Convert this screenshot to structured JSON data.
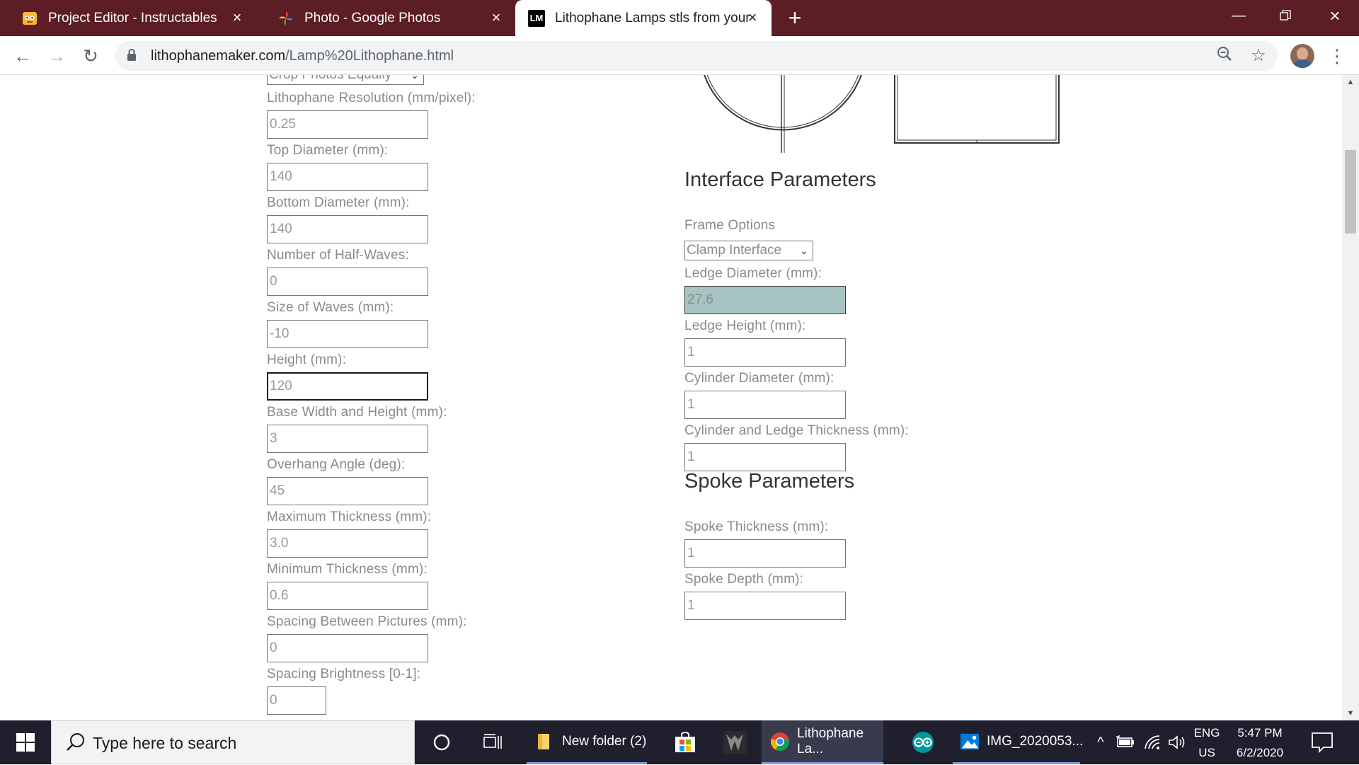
{
  "browser": {
    "tabs": [
      {
        "title": "Project Editor - Instructables",
        "icon": "instructables-robot-icon"
      },
      {
        "title": "Photo - Google Photos",
        "icon": "google-photos-pinwheel-icon"
      },
      {
        "title": "Lithophane Lamps stls from your",
        "icon": "lm-logo-icon",
        "favicon_text": "LM"
      }
    ],
    "url_host": "lithophanemaker.com",
    "url_path": "/Lamp%20Lithophane.html"
  },
  "form_left": {
    "crop_select": "Crop Photos Equally",
    "fields": [
      {
        "label": "Lithophane Resolution (mm/pixel):",
        "value": "0.25"
      },
      {
        "label": "Top Diameter (mm):",
        "value": "140"
      },
      {
        "label": "Bottom Diameter (mm):",
        "value": "140"
      },
      {
        "label": "Number of Half-Waves:",
        "value": "0"
      },
      {
        "label": "Size of Waves (mm):",
        "value": "-10"
      },
      {
        "label": "Height (mm):",
        "value": "120"
      },
      {
        "label": "Base Width and Height (mm):",
        "value": "3"
      },
      {
        "label": "Overhang Angle (deg):",
        "value": "45"
      },
      {
        "label": "Maximum Thickness (mm):",
        "value": "3.0"
      },
      {
        "label": "Minimum Thickness (mm):",
        "value": "0.6"
      },
      {
        "label": "Spacing Between Pictures (mm):",
        "value": "0"
      },
      {
        "label": "Spacing Brightness [0-1]:",
        "value": "0"
      }
    ]
  },
  "interface": {
    "heading": "Interface Parameters",
    "frame_label": "Frame Options",
    "frame_value": "Clamp Interface",
    "fields": [
      {
        "label": "Ledge Diameter (mm):",
        "value": "27.6"
      },
      {
        "label": "Ledge Height (mm):",
        "value": "1"
      },
      {
        "label": "Cylinder Diameter (mm):",
        "value": "1"
      },
      {
        "label": "Cylinder and Ledge Thickness (mm):",
        "value": "1"
      }
    ]
  },
  "spoke": {
    "heading": "Spoke Parameters",
    "fields": [
      {
        "label": "Spoke Thickness (mm):",
        "value": "1"
      },
      {
        "label": "Spoke Depth (mm):",
        "value": "1"
      }
    ]
  },
  "taskbar": {
    "search_placeholder": "Type here to search",
    "items": [
      {
        "label": "New folder (2)",
        "icon": "folder-icon"
      },
      {
        "label": "Lithophane La...",
        "icon": "chrome-icon"
      },
      {
        "label": "IMG_2020053...",
        "icon": "photos-app-icon"
      }
    ],
    "lang_top": "ENG",
    "lang_bottom": "US",
    "time": "5:47 PM",
    "date": "6/2/2020"
  },
  "colors": {
    "tabstrip": "#5c1d24",
    "highlight_input": "#a7c4c2",
    "taskbar": "#1f1f2e"
  }
}
